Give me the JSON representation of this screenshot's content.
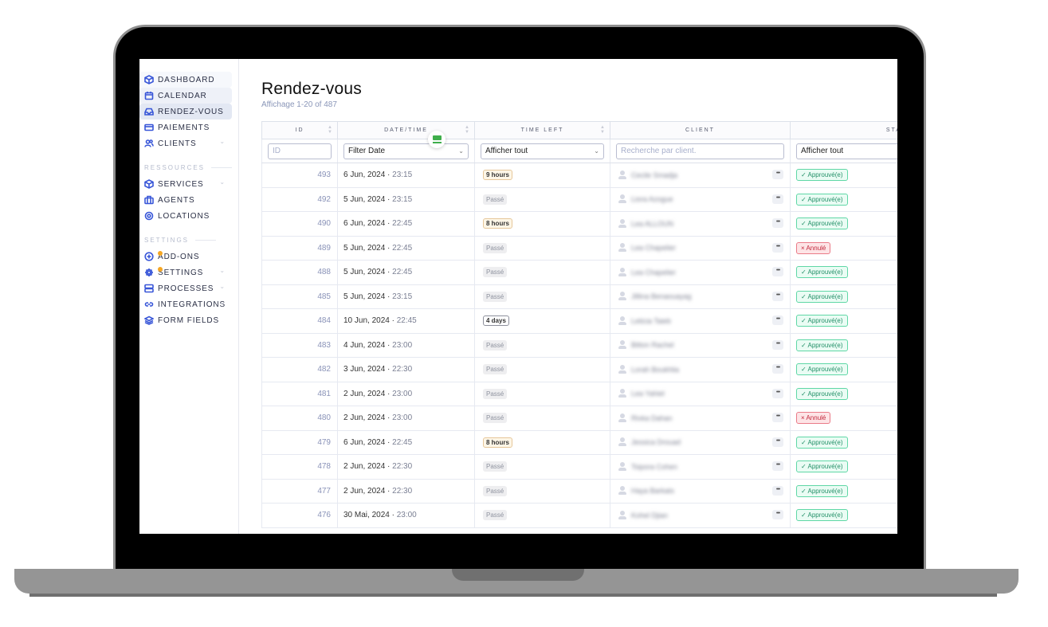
{
  "sidebar": {
    "items": [
      {
        "label": "DASHBOARD",
        "icon": "box-icon",
        "name": "dashboard"
      },
      {
        "label": "CALENDAR",
        "icon": "calendar-icon",
        "name": "calendar"
      },
      {
        "label": "RENDEZ-VOUS",
        "icon": "inbox-icon",
        "name": "rendez-vous",
        "active": true
      },
      {
        "label": "PAIEMENTS",
        "icon": "credit-card-icon",
        "name": "paiements"
      },
      {
        "label": "CLIENTS",
        "icon": "users-icon",
        "name": "clients",
        "expandable": true
      }
    ],
    "sections": [
      {
        "label": "RESSOURCES",
        "items": [
          {
            "label": "SERVICES",
            "icon": "box-icon",
            "expandable": true
          },
          {
            "label": "AGENTS",
            "icon": "briefcase-icon"
          },
          {
            "label": "LOCATIONS",
            "icon": "map-pin-icon"
          }
        ]
      },
      {
        "label": "SETTINGS",
        "items": [
          {
            "label": "ADD-ONS",
            "icon": "plus-circle-icon",
            "notification": true
          },
          {
            "label": "SETTINGS",
            "icon": "gear-icon",
            "notification": true,
            "expandable": true
          },
          {
            "label": "PROCESSES",
            "icon": "server-icon",
            "expandable": true
          },
          {
            "label": "INTEGRATIONS",
            "icon": "link-icon",
            "expandable": true
          },
          {
            "label": "FORM FIELDS",
            "icon": "layers-icon"
          }
        ]
      }
    ]
  },
  "page": {
    "title": "Rendez-vous",
    "subtitle": "Affichage 1-20 of 487"
  },
  "table": {
    "columns": [
      "ID",
      "DATE/TIME",
      "TIME LEFT",
      "CLIENT",
      "STATUT"
    ],
    "filters": {
      "id_placeholder": "ID",
      "date_value": "Filter Date",
      "time_left_value": "Afficher tout",
      "client_placeholder": "Recherche par client.",
      "status_value": "Afficher tout"
    },
    "rows": [
      {
        "id": "493",
        "date": "6 Jun, 2024",
        "time": "23:15",
        "time_left": "9 hours",
        "time_left_style": "warm",
        "client": "Cecile Smadja",
        "status": "Approuvé(e)",
        "status_type": "ok"
      },
      {
        "id": "492",
        "date": "5 Jun, 2024",
        "time": "23:15",
        "time_left": "Passé",
        "time_left_style": "past",
        "client": "Liora Azogue",
        "status": "Approuvé(e)",
        "status_type": "ok"
      },
      {
        "id": "490",
        "date": "6 Jun, 2024",
        "time": "22:45",
        "time_left": "8 hours",
        "time_left_style": "warm",
        "client": "Lea ALLOUN",
        "status": "Approuvé(e)",
        "status_type": "ok"
      },
      {
        "id": "489",
        "date": "5 Jun, 2024",
        "time": "22:45",
        "time_left": "Passé",
        "time_left_style": "past",
        "client": "Lea Chapelier",
        "status": "Annulé",
        "status_type": "ko"
      },
      {
        "id": "488",
        "date": "5 Jun, 2024",
        "time": "22:45",
        "time_left": "Passé",
        "time_left_style": "past",
        "client": "Lea Chapelier",
        "status": "Approuvé(e)",
        "status_type": "ok"
      },
      {
        "id": "485",
        "date": "5 Jun, 2024",
        "time": "23:15",
        "time_left": "Passé",
        "time_left_style": "past",
        "client": "Jillina Benaouayag",
        "status": "Approuvé(e)",
        "status_type": "ok"
      },
      {
        "id": "484",
        "date": "10 Jun, 2024",
        "time": "22:45",
        "time_left": "4 days",
        "time_left_style": "neutral",
        "client": "Leticia Taieb",
        "status": "Approuvé(e)",
        "status_type": "ok"
      },
      {
        "id": "483",
        "date": "4 Jun, 2024",
        "time": "23:00",
        "time_left": "Passé",
        "time_left_style": "past",
        "client": "Bitton Rachel",
        "status": "Approuvé(e)",
        "status_type": "ok"
      },
      {
        "id": "482",
        "date": "3 Jun, 2024",
        "time": "22:30",
        "time_left": "Passé",
        "time_left_style": "past",
        "client": "Lorah Boukhlia",
        "status": "Approuvé(e)",
        "status_type": "ok"
      },
      {
        "id": "481",
        "date": "2 Jun, 2024",
        "time": "23:00",
        "time_left": "Passé",
        "time_left_style": "past",
        "client": "Lea Yahiel",
        "status": "Approuvé(e)",
        "status_type": "ok"
      },
      {
        "id": "480",
        "date": "2 Jun, 2024",
        "time": "23:00",
        "time_left": "Passé",
        "time_left_style": "past",
        "client": "Rivka Dahan",
        "status": "Annulé",
        "status_type": "ko"
      },
      {
        "id": "479",
        "date": "6 Jun, 2024",
        "time": "22:45",
        "time_left": "8 hours",
        "time_left_style": "warm",
        "client": "Jessica Drouad",
        "status": "Approuvé(e)",
        "status_type": "ok"
      },
      {
        "id": "478",
        "date": "2 Jun, 2024",
        "time": "22:30",
        "time_left": "Passé",
        "time_left_style": "past",
        "client": "Tsipora Cohen",
        "status": "Approuvé(e)",
        "status_type": "ok"
      },
      {
        "id": "477",
        "date": "2 Jun, 2024",
        "time": "22:30",
        "time_left": "Passé",
        "time_left_style": "past",
        "client": "Haya Barkats",
        "status": "Approuvé(e)",
        "status_type": "ok"
      },
      {
        "id": "476",
        "date": "30 Mai, 2024",
        "time": "23:00",
        "time_left": "Passé",
        "time_left_style": "past",
        "client": "Kohel Djian",
        "status": "Approuvé(e)",
        "status_type": "ok"
      }
    ]
  },
  "colors": {
    "accent": "#3856d8",
    "approved": "#239068",
    "cancelled": "#c2283c",
    "notification": "#f5a623"
  }
}
